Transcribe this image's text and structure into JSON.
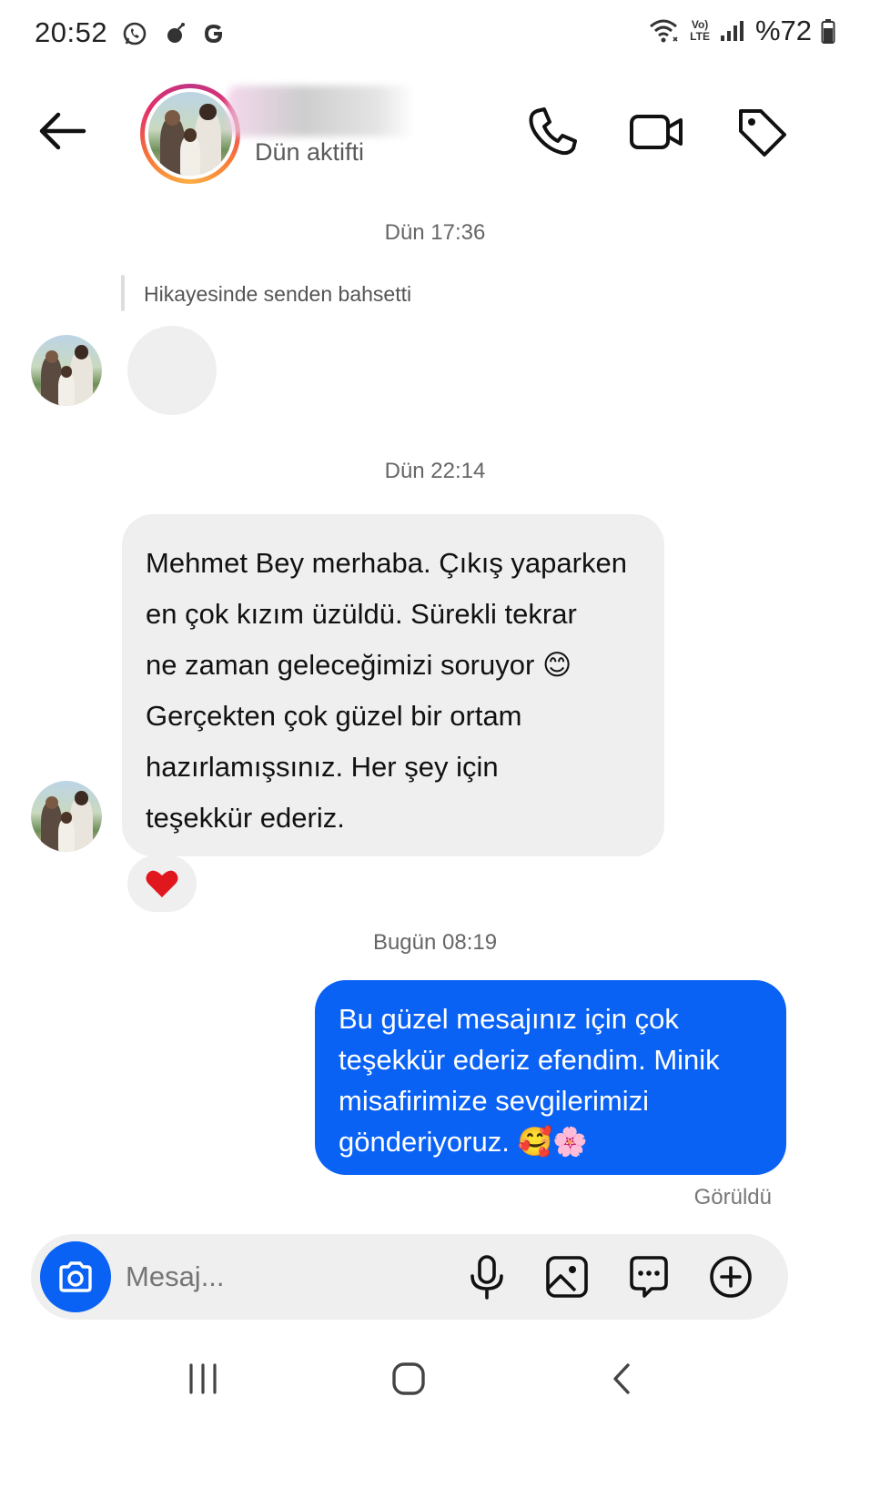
{
  "status_bar": {
    "time": "20:52",
    "left_icons": [
      "whatsapp-icon",
      "bomb-icon",
      "google-icon"
    ],
    "network_label_top": "Vo)",
    "network_label_bottom": "LTE",
    "battery": "%72"
  },
  "header": {
    "status": "Dün aktifti",
    "icons": [
      "back-arrow-icon",
      "phone-icon",
      "video-camera-icon",
      "tag-icon"
    ]
  },
  "conversation": {
    "ts1": "Dün 17:36",
    "story_mention": "Hikayesinde senden bahsetti",
    "ts2": "Dün 22:14",
    "incoming_lines": [
      "Mehmet Bey merhaba. Çıkış yaparken",
      "en çok kızım üzüldü. Sürekli tekrar",
      "ne zaman geleceğimizi soruyor",
      "Gerçekten çok güzel bir ortam",
      "hazırlamışsınız. Her şey için",
      "teşekkür ederiz."
    ],
    "incoming_emoji": "😊",
    "reaction": "❤️",
    "ts3": "Bugün 08:19",
    "outgoing_lines": [
      "Bu güzel mesajınız için çok",
      "teşekkür ederiz efendim. Minik",
      "misafirimize sevgilerimizi",
      "gönderiyoruz."
    ],
    "outgoing_emoji": "🥰🌸",
    "seen": "Görüldü"
  },
  "composer": {
    "placeholder": "Mesaj...",
    "icons": [
      "camera-icon",
      "microphone-icon",
      "gallery-icon",
      "sticker-chat-icon",
      "plus-icon"
    ]
  },
  "colors": {
    "accent_blue": "#0a62f5",
    "bubble_gray": "#efefef"
  }
}
